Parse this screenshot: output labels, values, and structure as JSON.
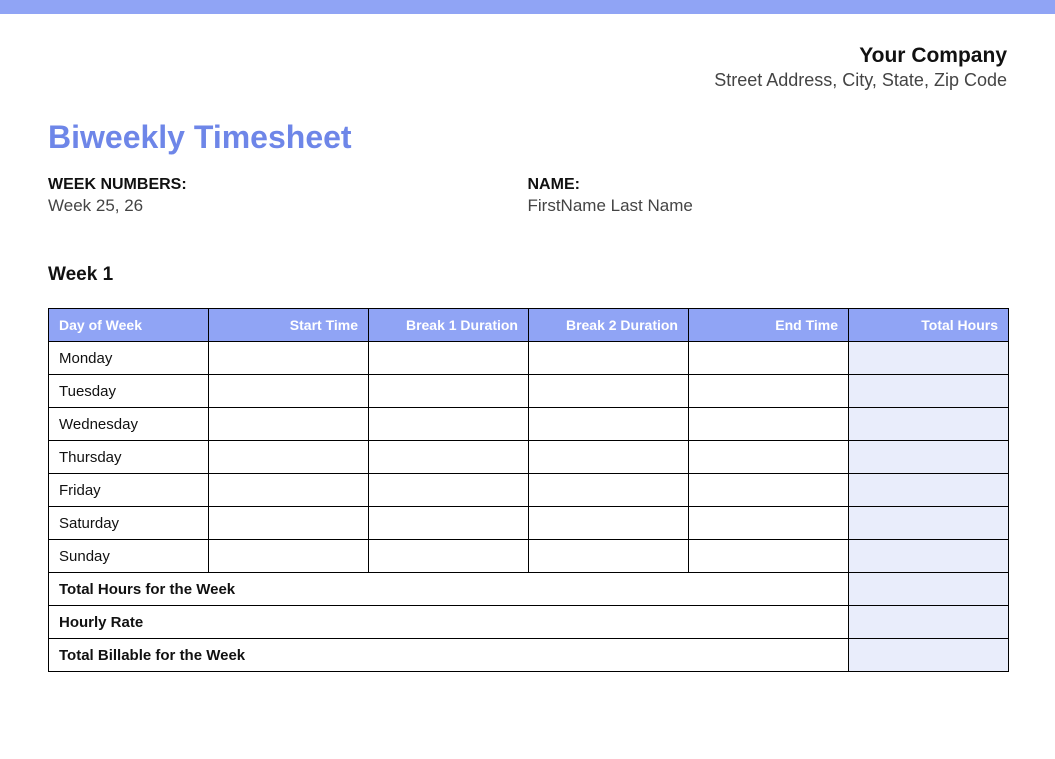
{
  "company": {
    "name": "Your Company",
    "address": "Street Address, City, State, Zip Code"
  },
  "title": "Biweekly Timesheet",
  "meta": {
    "week_numbers_label": "WEEK NUMBERS:",
    "week_numbers_value": "Week 25, 26",
    "name_label": "NAME:",
    "name_value": "FirstName Last Name"
  },
  "week1": {
    "label": "Week 1",
    "headers": {
      "day": "Day of Week",
      "start": "Start Time",
      "break1": "Break 1 Duration",
      "break2": "Break 2 Duration",
      "end": "End Time",
      "total": "Total Hours"
    },
    "rows": [
      {
        "day": "Monday",
        "start": "",
        "break1": "",
        "break2": "",
        "end": "",
        "total": ""
      },
      {
        "day": "Tuesday",
        "start": "",
        "break1": "",
        "break2": "",
        "end": "",
        "total": ""
      },
      {
        "day": "Wednesday",
        "start": "",
        "break1": "",
        "break2": "",
        "end": "",
        "total": ""
      },
      {
        "day": "Thursday",
        "start": "",
        "break1": "",
        "break2": "",
        "end": "",
        "total": ""
      },
      {
        "day": "Friday",
        "start": "",
        "break1": "",
        "break2": "",
        "end": "",
        "total": ""
      },
      {
        "day": "Saturday",
        "start": "",
        "break1": "",
        "break2": "",
        "end": "",
        "total": ""
      },
      {
        "day": "Sunday",
        "start": "",
        "break1": "",
        "break2": "",
        "end": "",
        "total": ""
      }
    ],
    "summary": {
      "total_hours_label": "Total Hours for the Week",
      "total_hours_value": "",
      "hourly_rate_label": "Hourly Rate",
      "hourly_rate_value": "",
      "total_billable_label": "Total Billable for the Week",
      "total_billable_value": ""
    }
  }
}
